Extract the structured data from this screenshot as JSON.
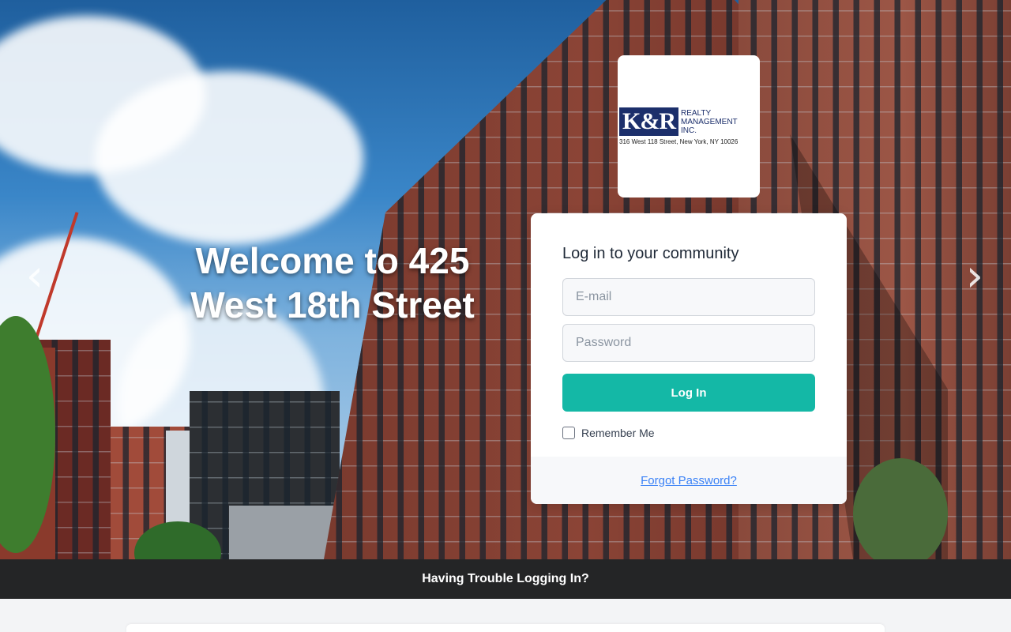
{
  "hero": {
    "welcome_line1": "Welcome to 425",
    "welcome_line2": "West 18th Street",
    "prev_icon": "chevron-left-icon",
    "next_icon": "chevron-right-icon",
    "prev_glyph": "‹",
    "next_glyph": "›"
  },
  "logo": {
    "mark": "K&R",
    "line1": "REALTY",
    "line2": "MANAGEMENT",
    "line3": "INC.",
    "address": "316 West 118 Street, New York, NY 10026",
    "brand_color": "#1c2f6b"
  },
  "login": {
    "title": "Log in to your community",
    "email_placeholder": "E-mail",
    "password_placeholder": "Password",
    "button_label": "Log In",
    "remember_label": "Remember Me",
    "forgot_label": "Forgot Password?",
    "button_color": "#14b8a6",
    "link_color": "#3b82f6"
  },
  "footer": {
    "trouble_label": "Having Trouble Logging In?"
  }
}
